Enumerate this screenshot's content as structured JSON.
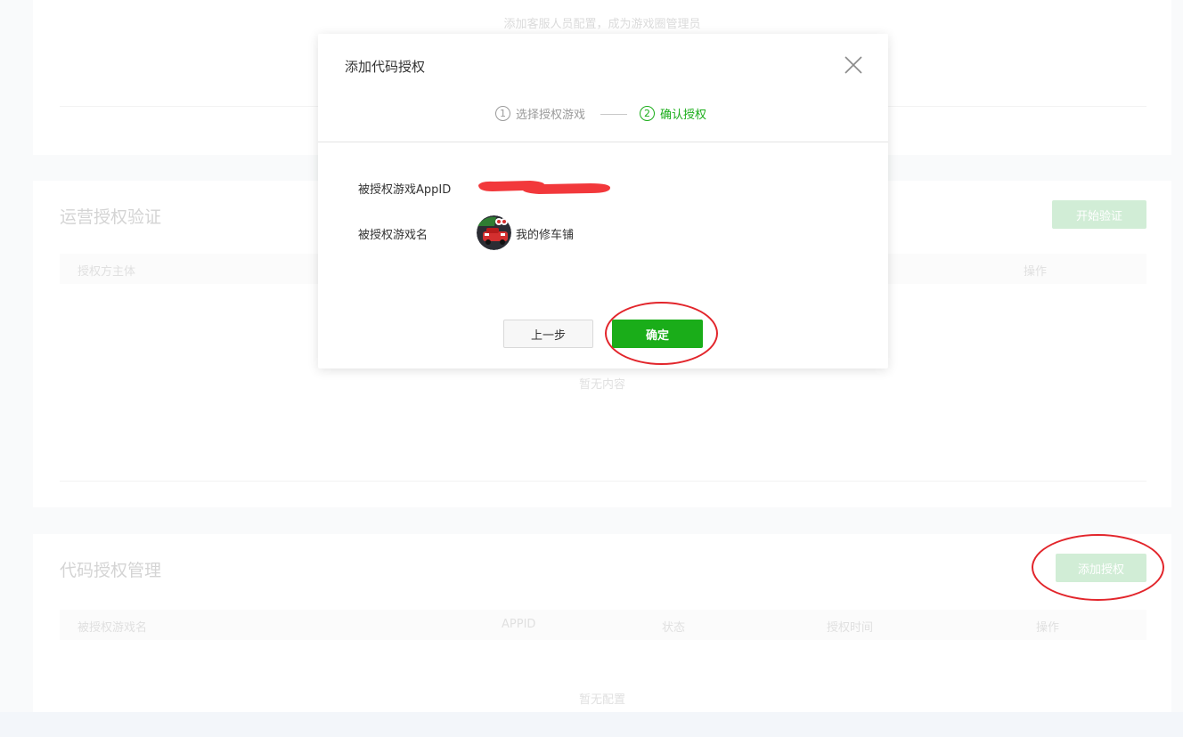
{
  "background": {
    "top_hint": "添加客服人员配置，成为游戏圈管理员",
    "ops_section": {
      "title": "运营授权验证",
      "start_button": "开始验证",
      "columns": [
        "授权方主体",
        "操作"
      ],
      "empty_text": "暂无内容"
    },
    "code_section": {
      "title": "代码授权管理",
      "add_button": "添加授权",
      "columns": [
        "被授权游戏名",
        "APPID",
        "状态",
        "授权时间",
        "操作"
      ],
      "empty_text": "暂无配置"
    }
  },
  "modal": {
    "title": "添加代码授权",
    "close_icon": "close-icon",
    "steps": [
      {
        "num": "1",
        "label": "选择授权游戏",
        "active": false
      },
      {
        "num": "2",
        "label": "确认授权",
        "active": true
      }
    ],
    "appid_label": "被授权游戏AppID",
    "appid_value_redacted": true,
    "game_name_label": "被授权游戏名",
    "game_name": "我的修车铺",
    "prev_button": "上一步",
    "confirm_button": "确定"
  },
  "colors": {
    "accent": "#1aad19",
    "accent_pale": "#b8e3c1",
    "annotation": "#e2252b",
    "redaction": "#f2383b"
  }
}
